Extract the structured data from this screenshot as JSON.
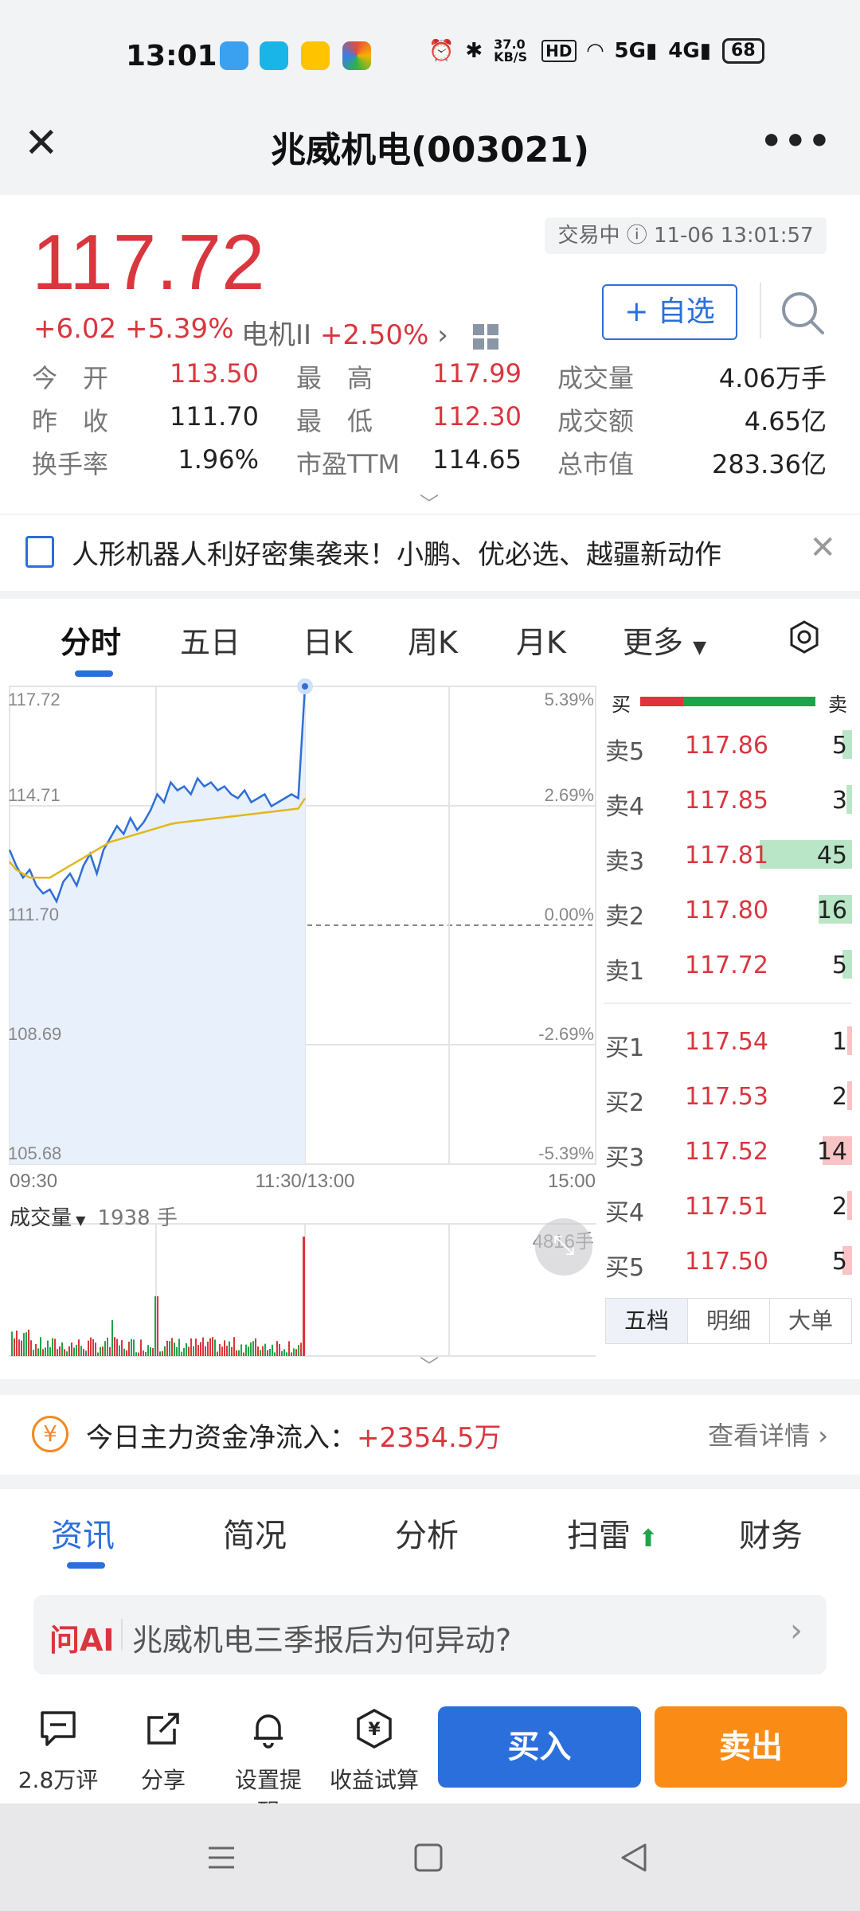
{
  "status_bar": {
    "time": "13:01",
    "speed": "37.0 KB/S",
    "battery": "68"
  },
  "header": {
    "title": "兆威机电(003021)"
  },
  "quote": {
    "price": "117.72",
    "status": "交易中 ⓘ 11-06 13:01:57",
    "change": "+6.02 +5.39%",
    "sector_name": "电机II",
    "sector_change": "+2.50%",
    "watch_label": "+ 自选",
    "stats": [
      {
        "l1": "今　开",
        "v1": "113.50",
        "l2": "最　高",
        "v2": "117.99",
        "l3": "成交量",
        "v3": "4.06万手"
      },
      {
        "l1": "昨　收",
        "v1": "111.70",
        "l2": "最　低",
        "v2": "112.30",
        "l3": "成交额",
        "v3": "4.65亿"
      },
      {
        "l1": "换手率",
        "v1": "1.96%",
        "l2": "市盈TTM",
        "v2": "114.65",
        "l3": "总市值",
        "v3": "283.36亿"
      }
    ]
  },
  "news": {
    "text": "人形机器人利好密集袭来！小鹏、优必选、越疆新动作"
  },
  "chart_tabs": [
    "分时",
    "五日",
    "日K",
    "周K",
    "月K",
    "更多"
  ],
  "chart_data": {
    "type": "line",
    "price_labels_left": [
      "117.72",
      "114.71",
      "111.70",
      "108.69",
      "105.68"
    ],
    "pct_labels_right": [
      "5.39%",
      "2.69%",
      "0.00%",
      "-2.69%",
      "-5.39%"
    ],
    "time_labels": [
      "09:30",
      "11:30/13:00",
      "15:00"
    ],
    "volume_title": "成交量",
    "volume_value": "1938 手",
    "volume_max": "4816手",
    "ylim": [
      105.68,
      117.72
    ],
    "series": [
      {
        "values": [
          113.6,
          113.2,
          112.9,
          113.1,
          112.7,
          112.5,
          112.6,
          112.3,
          112.8,
          113.0,
          112.7,
          113.2,
          113.5,
          113.0,
          113.6,
          113.9,
          114.2,
          114.0,
          114.4,
          114.1,
          114.3,
          114.6,
          115.0,
          114.8,
          115.3,
          115.1,
          115.2,
          115.0,
          115.4,
          115.2,
          115.3,
          115.1,
          115.2,
          115.0,
          114.9,
          115.1,
          114.8,
          114.9,
          115.0,
          114.7,
          114.8,
          114.9,
          115.0,
          114.9,
          117.72
        ]
      },
      {
        "values": [
          113.3,
          113.1,
          113.0,
          112.9,
          112.9,
          112.9,
          112.9,
          113.0,
          113.1,
          113.2,
          113.3,
          113.4,
          113.5,
          113.6,
          113.7,
          113.8,
          113.85,
          113.9,
          113.95,
          114.0,
          114.05,
          114.1,
          114.15,
          114.2,
          114.25,
          114.28,
          114.3,
          114.32,
          114.34,
          114.36,
          114.38,
          114.4,
          114.42,
          114.44,
          114.46,
          114.48,
          114.5,
          114.52,
          114.54,
          114.56,
          114.58,
          114.6,
          114.62,
          114.64,
          114.9
        ]
      }
    ]
  },
  "orderbook": {
    "bar_buy": "买",
    "bar_sell": "卖",
    "asks": [
      {
        "label": "卖5",
        "price": "117.86",
        "vol": "5",
        "w": 0.1
      },
      {
        "label": "卖4",
        "price": "117.85",
        "vol": "3",
        "w": 0.06
      },
      {
        "label": "卖3",
        "price": "117.81",
        "vol": "45",
        "w": 1.0
      },
      {
        "label": "卖2",
        "price": "117.80",
        "vol": "16",
        "w": 0.36
      },
      {
        "label": "卖1",
        "price": "117.72",
        "vol": "5",
        "w": 0.1
      }
    ],
    "bids": [
      {
        "label": "买1",
        "price": "117.54",
        "vol": "1",
        "w": 0.03
      },
      {
        "label": "买2",
        "price": "117.53",
        "vol": "2",
        "w": 0.05
      },
      {
        "label": "买3",
        "price": "117.52",
        "vol": "14",
        "w": 0.32
      },
      {
        "label": "买4",
        "price": "117.51",
        "vol": "2",
        "w": 0.05
      },
      {
        "label": "买5",
        "price": "117.50",
        "vol": "5",
        "w": 0.1
      }
    ],
    "tabs": [
      "五档",
      "明细",
      "大单"
    ]
  },
  "fund_flow": {
    "label": "今日主力资金净流入：",
    "value": "+2354.5万",
    "more": "查看详情"
  },
  "info_tabs": [
    "资讯",
    "简况",
    "分析",
    "扫雷",
    "财务"
  ],
  "ask_ai": {
    "tag": "问AI",
    "question": "兆威机电三季报后为何异动?"
  },
  "bottom": {
    "comments": "2.8万评",
    "share": "分享",
    "alert": "设置提醒",
    "calc": "收益试算",
    "buy": "买入",
    "sell": "卖出"
  },
  "colors": {
    "red": "#d9363e",
    "green": "#1fa34a",
    "blue": "#2a6fdb",
    "orange": "#fa8c16"
  }
}
